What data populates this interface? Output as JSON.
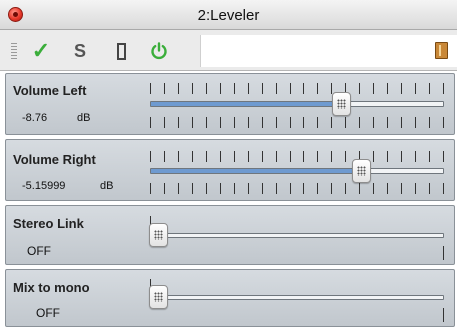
{
  "window": {
    "title": "2:Leveler"
  },
  "toolbar": {
    "icons": [
      "grip-icon",
      "checkmark-icon",
      "solo-icon",
      "bypass-icon",
      "power-icon",
      "book-icon"
    ],
    "solo_label": "S",
    "check_glyph": "✓",
    "check_color": "#3bae3b",
    "power_color": "#3bae3b"
  },
  "parameters": [
    {
      "label": "Volume Left",
      "value": "-8.76",
      "unit": "dB",
      "level": 0.65
    },
    {
      "label": "Volume Right",
      "value": "-5.15999",
      "unit": "dB",
      "level": 0.72
    },
    {
      "label": "Stereo Link",
      "value": "OFF",
      "unit": "",
      "level": 0.0
    },
    {
      "label": "Mix to mono",
      "value": "OFF",
      "unit": "",
      "level": 0.0
    }
  ],
  "colors": {
    "panel_top": "#d6dbe0",
    "panel_bottom": "#c1c7cd",
    "slider_fill": "#6e9ad0"
  }
}
